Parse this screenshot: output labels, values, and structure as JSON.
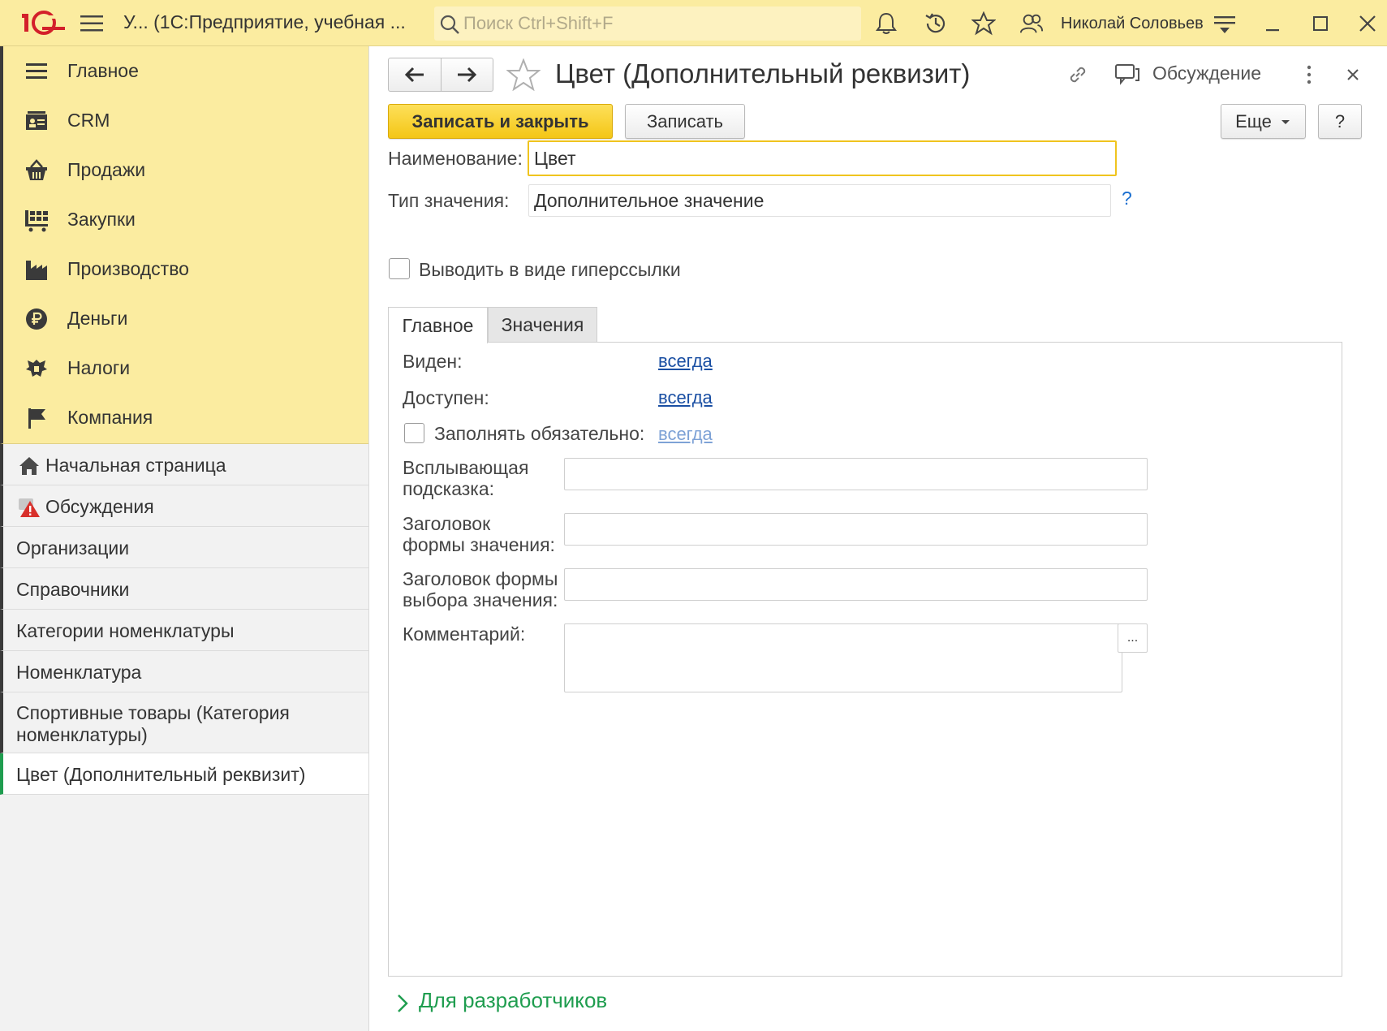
{
  "topbar": {
    "logo_text": "1С",
    "app_title": "У... (1С:Предприятие, учебная ...",
    "search_placeholder": "Поиск Ctrl+Shift+F",
    "user_name": "Николай Соловьев"
  },
  "sidebar": {
    "sections": [
      {
        "label": "Главное",
        "icon": "hamburger-icon"
      },
      {
        "label": "CRM",
        "icon": "contact-card-icon"
      },
      {
        "label": "Продажи",
        "icon": "shopping-basket-icon"
      },
      {
        "label": "Закупки",
        "icon": "cart-icon"
      },
      {
        "label": "Производство",
        "icon": "factory-icon"
      },
      {
        "label": "Деньги",
        "icon": "ruble-coin-icon"
      },
      {
        "label": "Налоги",
        "icon": "coat-of-arms-icon"
      },
      {
        "label": "Компания",
        "icon": "flag-icon"
      }
    ],
    "open_windows": [
      {
        "label": "Начальная страница",
        "icon": "home-icon"
      },
      {
        "label": "Обсуждения",
        "icon": "discussion-alert-icon"
      },
      {
        "label": "Организации"
      },
      {
        "label": "Справочники"
      },
      {
        "label": "Категории номенклатуры"
      },
      {
        "label": "Номенклатура"
      },
      {
        "label": "Спортивные товары (Категория номенклатуры)"
      },
      {
        "label": "Цвет (Дополнительный реквизит)"
      }
    ]
  },
  "form": {
    "title": "Цвет (Дополнительный реквизит)",
    "discussion_label": "Обсуждение",
    "buttons": {
      "save_close": "Записать и закрыть",
      "save": "Записать",
      "more": "Еще",
      "help": "?"
    },
    "name_label": "Наименование:",
    "name_value": "Цвет",
    "type_label": "Тип значения:",
    "type_value": "Дополнительное значение",
    "type_help": "?",
    "hyperlink_checkbox_label": "Выводить в виде гиперссылки",
    "tabs": [
      "Главное",
      "Значения"
    ],
    "main_tab": {
      "visible_label": "Виден:",
      "visible_value": "всегда",
      "available_label": "Доступен:",
      "available_value": "всегда",
      "required_label": "Заполнять обязательно:",
      "required_value": "всегда",
      "tooltip_label_1": "Всплывающая",
      "tooltip_label_2": "подсказка:",
      "value_form_title_label_1": "Заголовок",
      "value_form_title_label_2": "формы значения:",
      "choice_form_title_label_1": "Заголовок формы",
      "choice_form_title_label_2": "выбора значения:",
      "comment_label": "Комментарий:",
      "comment_button": "..."
    },
    "developers_label": "Для разработчиков"
  },
  "colors": {
    "topbar_bg": "#fbeca0",
    "primary_button": "#f4c616",
    "link": "#1a4fa3",
    "developer_section": "#1f9d4f"
  }
}
